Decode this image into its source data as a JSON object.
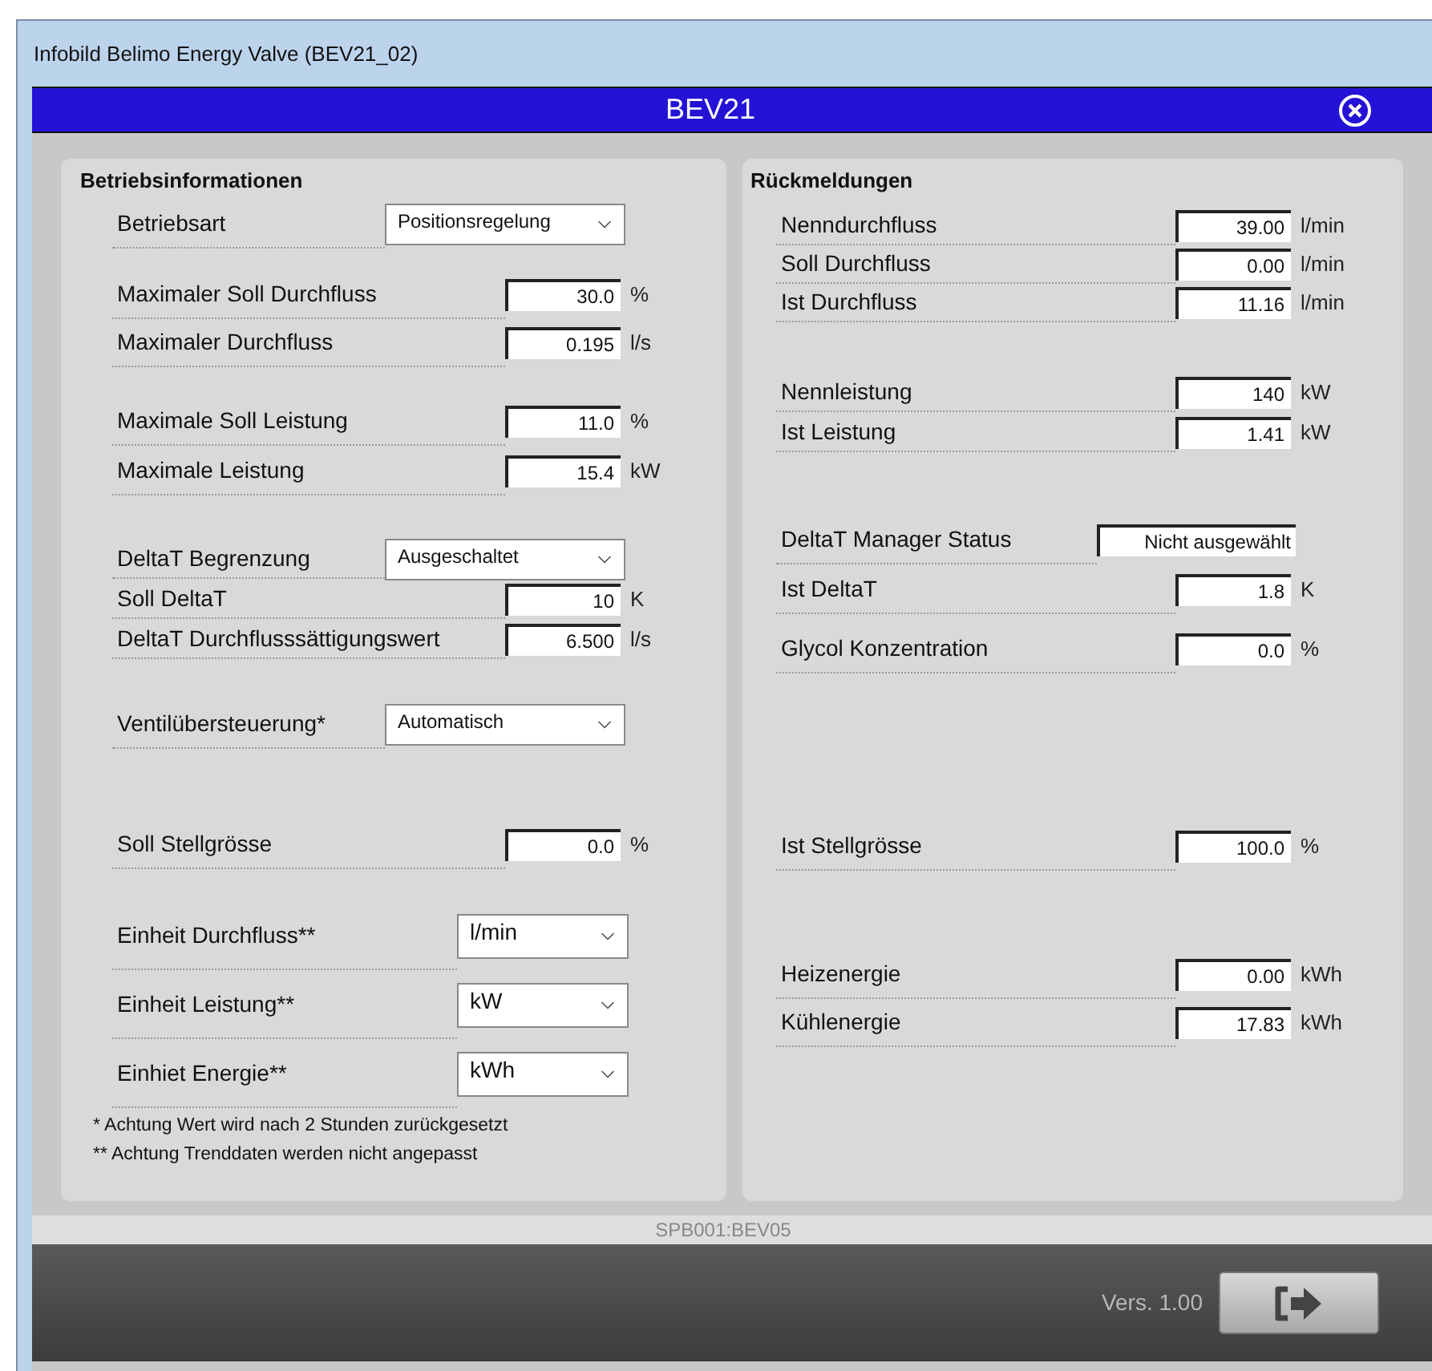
{
  "window": {
    "title": "Infobild Belimo Energy Valve (BEV21_02)"
  },
  "header": {
    "title": "BEV21"
  },
  "left_panel": {
    "title": "Betriebsinformationen",
    "groups": [
      {
        "rows": [
          {
            "kind": "select",
            "label": "Betriebsart",
            "value": "Positionsregelung"
          }
        ]
      },
      {
        "rows": [
          {
            "kind": "input",
            "label": "Maximaler Soll Durchfluss",
            "value": "30.0",
            "unit": "%"
          },
          {
            "kind": "input",
            "label": "Maximaler Durchfluss",
            "value": "0.195",
            "unit": "l/s"
          }
        ]
      },
      {
        "rows": [
          {
            "kind": "input",
            "label": "Maximale Soll Leistung",
            "value": "11.0",
            "unit": "%"
          },
          {
            "kind": "input",
            "label": "Maximale Leistung",
            "value": "15.4",
            "unit": "kW"
          }
        ]
      },
      {
        "rows": [
          {
            "kind": "select",
            "label": "DeltaT Begrenzung",
            "value": "Ausgeschaltet"
          },
          {
            "kind": "input",
            "label": "Soll DeltaT",
            "value": "10",
            "unit": "K"
          },
          {
            "kind": "input",
            "label": "DeltaT Durchflusssättigungswert",
            "value": "6.500",
            "unit": "l/s"
          }
        ]
      },
      {
        "rows": [
          {
            "kind": "select",
            "label": "Ventilübersteuerung*",
            "value": "Automatisch"
          }
        ]
      },
      {
        "rows": [
          {
            "kind": "input",
            "label": "Soll Stellgrösse",
            "value": "0.0",
            "unit": "%"
          }
        ]
      },
      {
        "rows": [
          {
            "kind": "unitselect",
            "label": "Einheit Durchfluss**",
            "value": "l/min"
          },
          {
            "kind": "unitselect",
            "label": "Einheit Leistung**",
            "value": "kW"
          },
          {
            "kind": "unitselect",
            "label": "Einhiet Energie**",
            "value": "kWh"
          }
        ]
      }
    ],
    "notes": [
      "* Achtung Wert wird nach 2 Stunden zurückgesetzt",
      "** Achtung Trenddaten werden nicht angepasst"
    ]
  },
  "right_panel": {
    "title": "Rückmeldungen",
    "groups": [
      {
        "rows": [
          {
            "kind": "input",
            "label": "Nenndurchfluss",
            "value": "39.00",
            "unit": "l/min"
          },
          {
            "kind": "input",
            "label": "Soll Durchfluss",
            "value": "0.00",
            "unit": "l/min"
          },
          {
            "kind": "input",
            "label": "Ist Durchfluss",
            "value": "11.16",
            "unit": "l/min"
          }
        ]
      },
      {
        "rows": [
          {
            "kind": "input",
            "label": "Nennleistung",
            "value": "140",
            "unit": "kW"
          },
          {
            "kind": "input",
            "label": "Ist Leistung",
            "value": "1.41",
            "unit": "kW"
          }
        ]
      },
      {
        "rows": [
          {
            "kind": "status",
            "label": "DeltaT Manager Status",
            "value": "Nicht ausgewählt"
          }
        ]
      },
      {
        "rows": [
          {
            "kind": "input",
            "label": "Ist DeltaT",
            "value": "1.8",
            "unit": "K"
          }
        ]
      },
      {
        "rows": [
          {
            "kind": "input",
            "label": "Glycol Konzentration",
            "value": "0.0",
            "unit": "%"
          }
        ]
      },
      {
        "rows": [
          {
            "kind": "input",
            "label": "Ist Stellgrösse",
            "value": "100.0",
            "unit": "%"
          }
        ]
      },
      {
        "rows": [
          {
            "kind": "input",
            "label": "Heizenergie",
            "value": "0.00",
            "unit": "kWh"
          },
          {
            "kind": "input",
            "label": "Kühlenergie",
            "value": "17.83",
            "unit": "kWh"
          }
        ]
      }
    ]
  },
  "status_bar": {
    "text": "SPB001:BEV05"
  },
  "footer": {
    "version": "Vers. 1.00"
  }
}
